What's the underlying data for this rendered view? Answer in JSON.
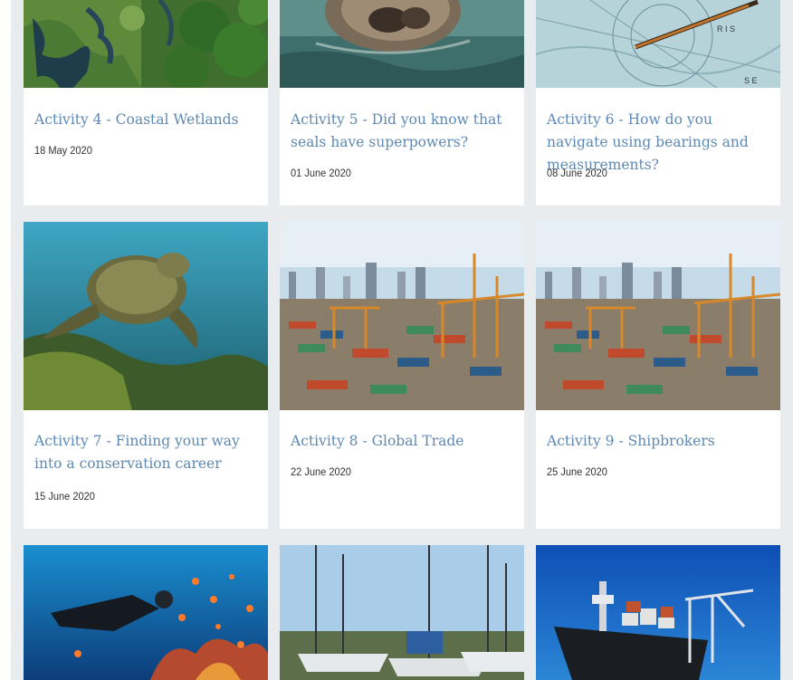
{
  "cards": [
    {
      "title": "Activity 4 - Coastal Wetlands",
      "date": "18 May 2020",
      "image": "coastal-wetlands-aerial-photo"
    },
    {
      "title": "Activity 5 - Did you know that seals have superpowers?",
      "date": "01 June 2020",
      "image": "seal-in-water-photo"
    },
    {
      "title": "Activity 6 - How do you navigate using bearings and measurements?",
      "date": "08 June 2020",
      "image": "nautical-chart-pencil-photo"
    },
    {
      "title": "Activity 7 - Finding your way into a conservation career",
      "date": "15 June 2020",
      "image": "sea-turtle-underwater-photo"
    },
    {
      "title": "Activity 8 - Global Trade",
      "date": "22 June 2020",
      "image": "container-port-photo"
    },
    {
      "title": "Activity 9 - Shipbrokers",
      "date": "25 June 2020",
      "image": "container-port-photo"
    },
    {
      "title": "",
      "date": "",
      "image": "scuba-diver-coral-reef-photo"
    },
    {
      "title": "",
      "date": "",
      "image": "marina-sailboats-photo"
    },
    {
      "title": "",
      "date": "",
      "image": "cargo-ship-crane-photo"
    }
  ],
  "colors": {
    "page_background": "#e9ecef",
    "card_background": "#ffffff",
    "title_link": "#5e89b4",
    "date_text": "#333333"
  }
}
